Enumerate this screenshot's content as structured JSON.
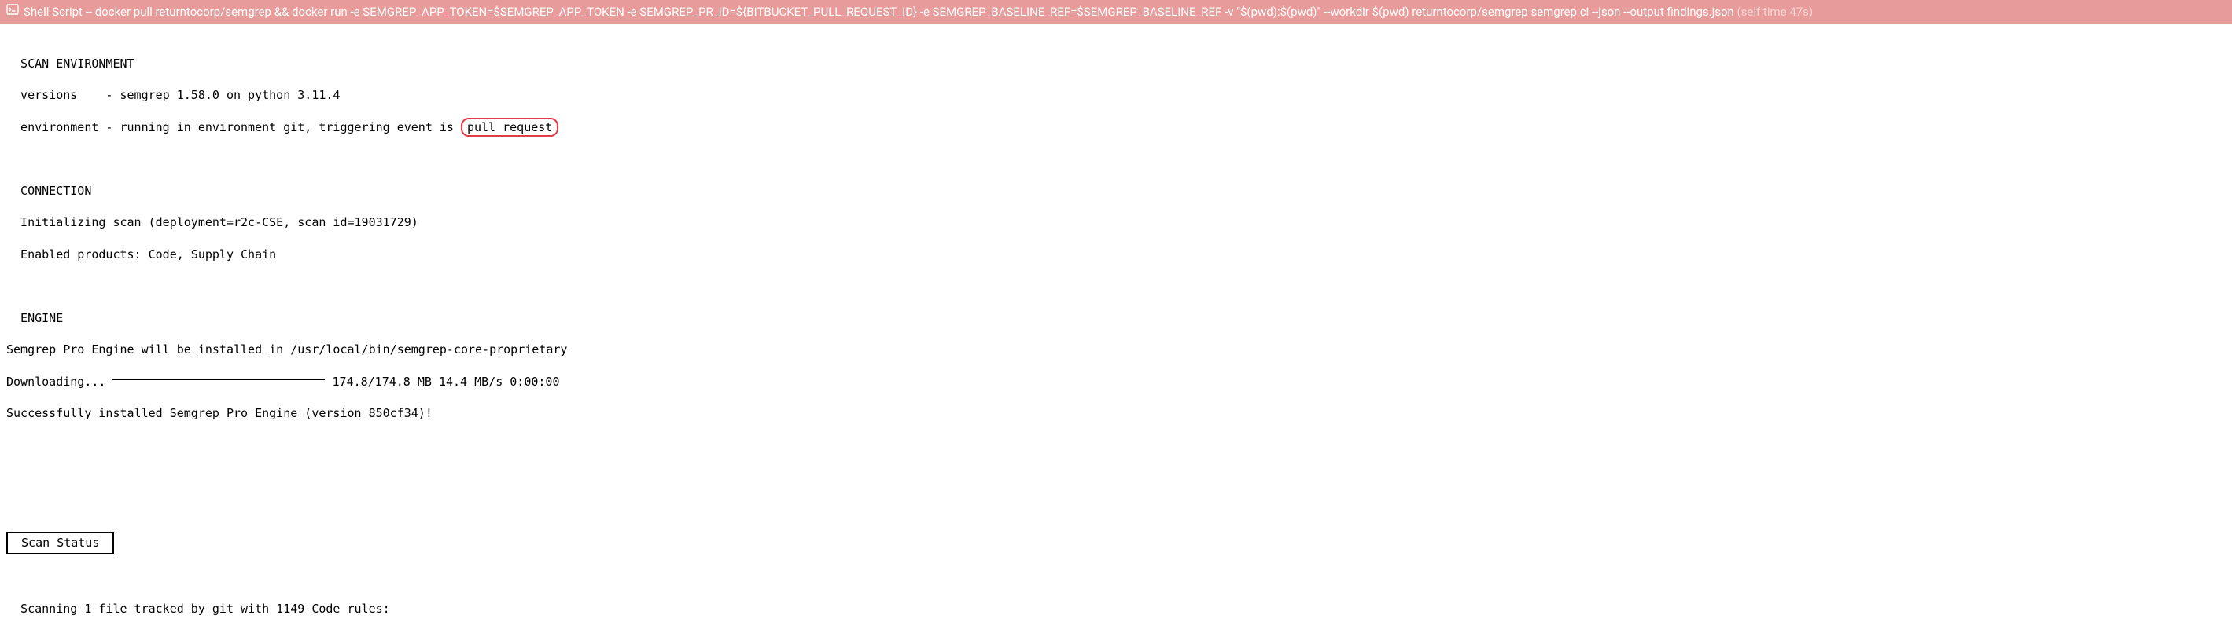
{
  "header": {
    "label": "Shell Script",
    "separator": " -- ",
    "command": "docker pull returntocorp/semgrep && docker run -e SEMGREP_APP_TOKEN=$SEMGREP_APP_TOKEN -e SEMGREP_PR_ID=${BITBUCKET_PULL_REQUEST_ID} -e SEMGREP_BASELINE_REF=$SEMGREP_BASELINE_REF -v \"$(pwd):$(pwd)\" --workdir $(pwd) returntocorp/semgrep semgrep ci --json --output findings.json",
    "self_time": "(self time 47s)"
  },
  "output": {
    "scan_env_header": "  SCAN ENVIRONMENT",
    "versions_line": "  versions    - semgrep 1.58.0 on python 3.11.4",
    "env_prefix": "  environment - running in environment git, triggering event is ",
    "env_highlight": "pull_request",
    "connection_header": "  CONNECTION",
    "init_scan": "  Initializing scan (deployment=r2c-CSE, scan_id=19031729)",
    "enabled_products": "  Enabled products: Code, Supply Chain",
    "engine_header": "  ENGINE",
    "engine_install": "Semgrep Pro Engine will be installed in /usr/local/bin/semgrep-core-proprietary",
    "downloading_prefix": "Downloading... ",
    "downloading_stats": " 174.8/174.8 MB 14.4 MB/s 0:00:00",
    "install_success": "Successfully installed Semgrep Pro Engine (version 850cf34)!",
    "scan_status_label": " Scan Status ",
    "scanning_line": "  Scanning 1 file tracked by git with 1149 Code rules:"
  }
}
